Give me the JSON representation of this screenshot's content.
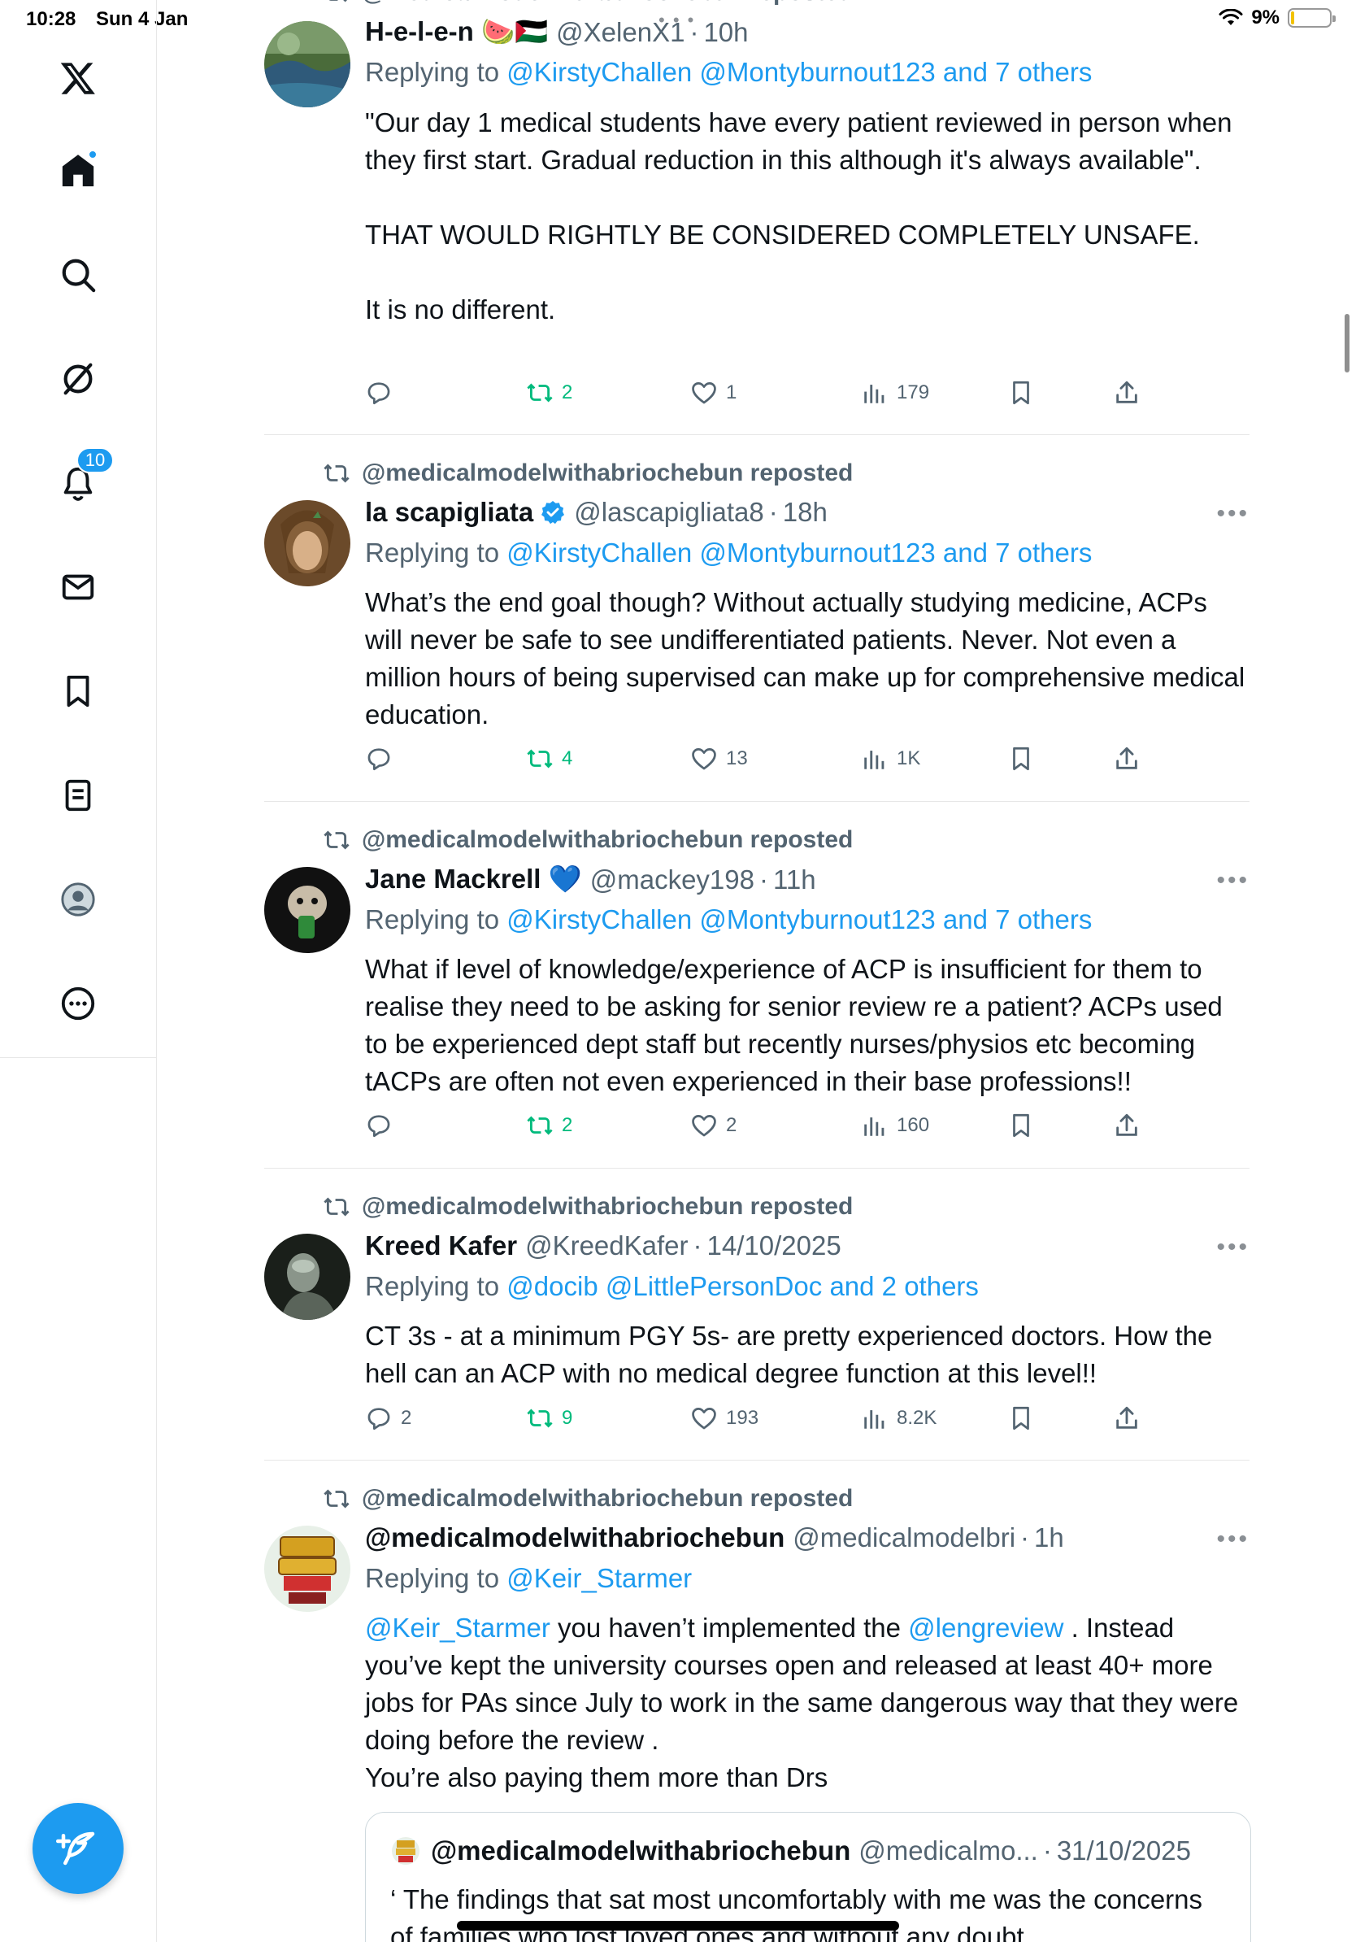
{
  "status_bar": {
    "time": "10:28",
    "date": "Sun 4 Jan",
    "battery_pct": "9%",
    "battery_level": 0.09
  },
  "nav": {
    "notifications_badge": "10",
    "items": [
      "x-logo-icon",
      "home-icon",
      "search-icon",
      "grok-icon",
      "bell-icon",
      "mail-icon",
      "bookmark-icon",
      "lists-icon",
      "profile-icon",
      "more-icon"
    ]
  },
  "colors": {
    "accent": "#1d9bf0",
    "repost_green": "#00ba7c",
    "secondary_text": "#536471"
  },
  "tweets": [
    {
      "repost_label": "@medicalmodelwithabriochebun reposted",
      "name": "H-e-l-e-n 🍉🇵🇸",
      "handle": "@XelenX1",
      "time": "10h",
      "replying_prefix": "Replying to",
      "replying_to": "@KirstyChallen @Montyburnout123 and 7 others",
      "body": "\"Our day 1 medical students have every patient reviewed in person when they first start. Gradual reduction in this although it's always available\".\n\nTHAT WOULD RIGHTLY BE CONSIDERED COMPLETELY UNSAFE.\n\nIt is no different.",
      "replies": "",
      "reposts": "2",
      "likes": "1",
      "views": "179"
    },
    {
      "repost_label": "@medicalmodelwithabriochebun reposted",
      "name": "la scapigliata",
      "handle": "@lascapigliata8",
      "time": "18h",
      "replying_prefix": "Replying to",
      "replying_to": "@KirstyChallen @Montyburnout123 and 7 others",
      "body": "What’s the end goal though? Without actually studying medicine, ACPs will never be safe to see undifferentiated patients. Never. Not even a million hours of being supervised can make up for comprehensive medical education.",
      "replies": "",
      "reposts": "4",
      "likes": "13",
      "views": "1K"
    },
    {
      "repost_label": "@medicalmodelwithabriochebun reposted",
      "name": "Jane Mackrell 💙",
      "handle": "@mackey198",
      "time": "11h",
      "replying_prefix": "Replying to",
      "replying_to": "@KirstyChallen @Montyburnout123 and 7 others",
      "body": "What if level of knowledge/experience of ACP is insufficient for them to realise they need to be asking for senior review re a patient? ACPs used to be experienced dept staff but recently nurses/physios etc becoming tACPs are often not even experienced in their base professions!!",
      "replies": "",
      "reposts": "2",
      "likes": "2",
      "views": "160"
    },
    {
      "repost_label": "@medicalmodelwithabriochebun reposted",
      "name": "Kreed Kafer",
      "handle": "@KreedKafer",
      "time": "14/10/2025",
      "replying_prefix": "Replying to",
      "replying_to": "@docib @LittlePersonDoc and 2 others",
      "body": "CT 3s - at a minimum PGY 5s- are pretty experienced doctors. How the hell can an ACP with no medical degree function at this level!!",
      "replies": "2",
      "reposts": "9",
      "likes": "193",
      "views": "8.2K"
    },
    {
      "repost_label": "@medicalmodelwithabriochebun reposted",
      "name": "@medicalmodelwithabriochebun",
      "handle": "@medicalmodelbri",
      "time": "1h",
      "replying_prefix": "Replying to",
      "replying_to": "@Keir_Starmer",
      "body_mention1": "@Keir_Starmer",
      "body_part1": " you haven’t implemented the ",
      "body_mention2": "@lengreview",
      "body_part2": " . Instead you’ve kept the university courses open and released at least 40+ more jobs for PAs since July to work in the same dangerous way that they were doing before the review .\nYou’re also paying them more than Drs",
      "quote": {
        "name": "@medicalmodelwithabriochebun",
        "handle": "@medicalmo...",
        "time": "31/10/2025",
        "body": "‘ The findings that sat most uncomfortably with me was the concerns of families who lost loved ones and without any doubt"
      }
    }
  ]
}
